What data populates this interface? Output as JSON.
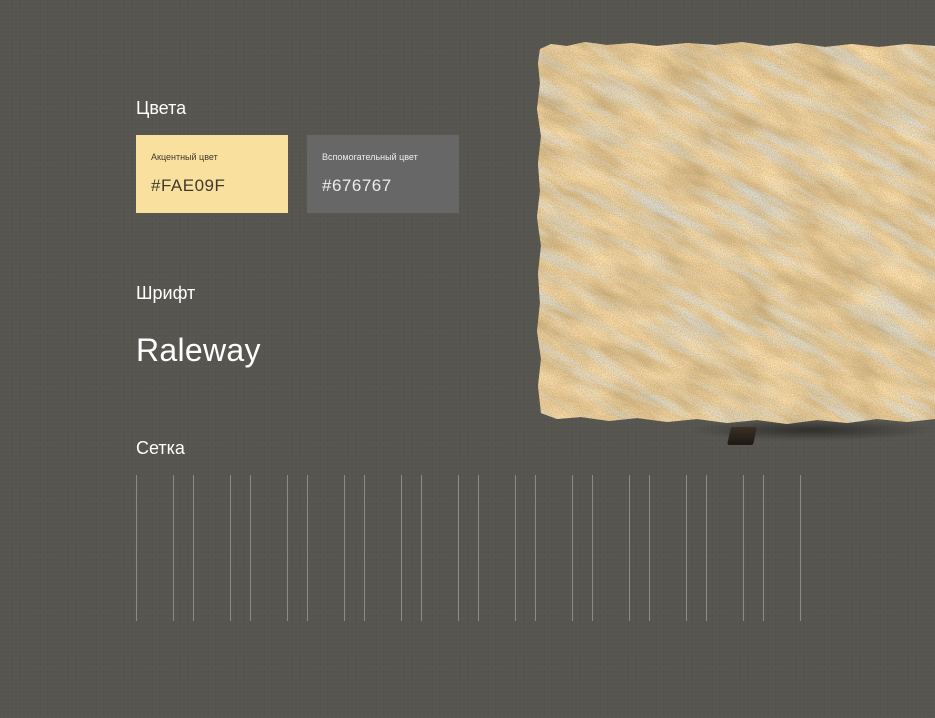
{
  "sections": {
    "colors": {
      "heading": "Цвета",
      "accent": {
        "label": "Акцентный цвет",
        "hex_text": "#FAE09F",
        "color": "#FAE09F"
      },
      "secondary": {
        "label": "Вспомогательный цвет",
        "hex_text": "#676767",
        "color": "#676767"
      }
    },
    "font": {
      "heading": "Шрифт",
      "sample": "Raleway"
    },
    "grid": {
      "heading": "Сетка",
      "columns": 12
    }
  },
  "image": {
    "icon": "granite-slab-image"
  },
  "colors": {
    "background": "#575550",
    "text": "#FFFFFF"
  }
}
